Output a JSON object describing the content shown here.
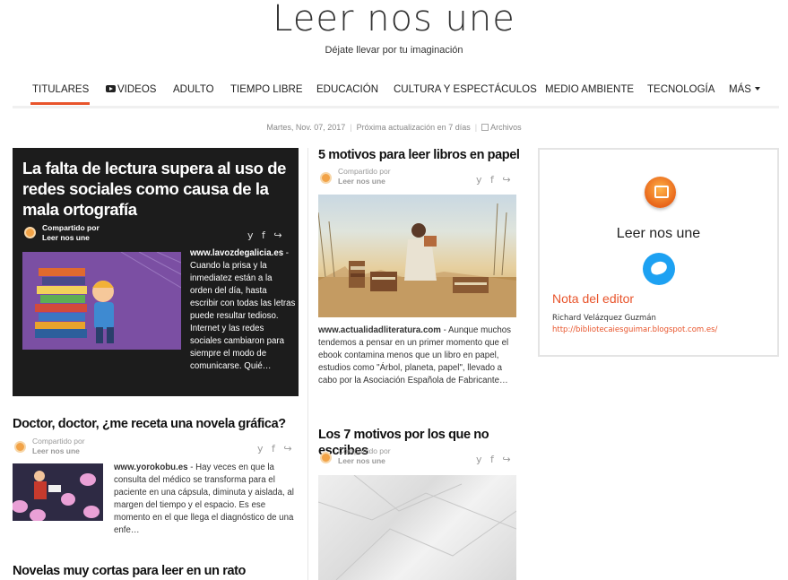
{
  "site": {
    "title": "Leer nos une",
    "tagline": "Déjate llevar por tu imaginación"
  },
  "nav": {
    "items": [
      {
        "label": "TITULARES",
        "active": true
      },
      {
        "label": "VIDEOS",
        "icon": "youtube-icon"
      },
      {
        "label": "ADULTO"
      },
      {
        "label": "TIEMPO LIBRE"
      },
      {
        "label": "EDUCACIÓN"
      },
      {
        "label": "CULTURA Y ESPECTÁCULOS"
      },
      {
        "label": "MEDIO AMBIENTE"
      },
      {
        "label": "TECNOLOGÍA"
      },
      {
        "label": "MÁS",
        "icon": "caret-down-icon"
      }
    ],
    "accent": "#e8542b"
  },
  "dateline": {
    "date": "Martes, Nov. 07, 2017",
    "update": "Próxima actualización en 7 días",
    "archive": "Archivos"
  },
  "shared": {
    "label": "Compartido por",
    "by": "Leer nos une"
  },
  "articles": [
    {
      "title": "La falta de lectura supera al uso de redes sociales como causa de la mala ortografía",
      "source": "www.lavozdegalicia.es",
      "excerpt": " - Cuando la prisa y la inmediatez están a la orden del día, hasta escribir con todas las letras puede resultar tedioso. Internet y las redes sociales cambiaron para siempre el modo de comunicarse. Quié…"
    },
    {
      "title": "Doctor, doctor, ¿me receta una novela gráfica?",
      "source": "www.yorokobu.es",
      "excerpt": " - Hay veces en que la consulta del médico se transforma para el paciente en una cápsula, diminuta y aislada, al margen del tiempo y el espacio. Es ese momento en el que llega el diagnóstico de una enfe…"
    },
    {
      "title": "Novelas muy cortas para leer en un rato"
    },
    {
      "title": "5 motivos para leer libros en papel",
      "source": "www.actualidadliteratura.com",
      "excerpt": " - Aunque muchos tendemos a pensar en un primer momento que el ebook contamina menos que un libro en papel, estudios como \"Árbol, planeta, papel\", llevado a cabo por la Asociación Española de Fabricante…"
    },
    {
      "title": "Los 7 motivos por los que no escribes"
    }
  ],
  "social_icons": "y f ↪",
  "sidebar": {
    "name": "Leer nos une",
    "note_title": "Nota del editor",
    "author": "Richard Velázquez Guzmán",
    "link": "http://bibliotecaiesguimar.blogspot.com.es/"
  }
}
